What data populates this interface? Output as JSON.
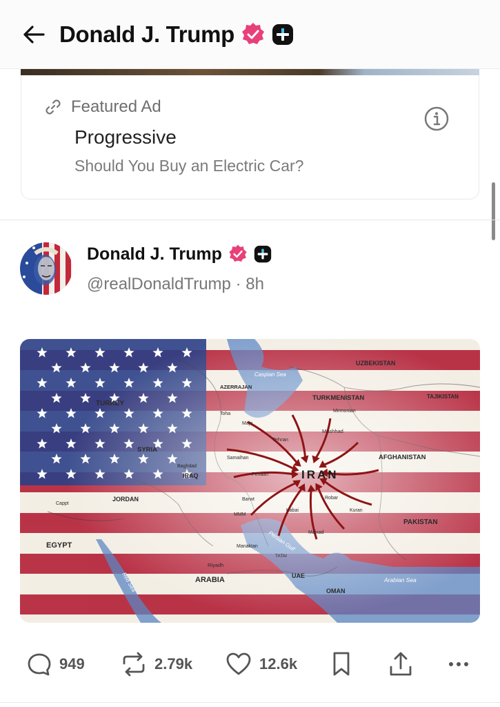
{
  "header": {
    "title": "Donald J. Trump",
    "back_icon": "back-arrow-icon",
    "verified_icon": "verified-badge-icon",
    "plus_icon": "plus-badge-icon"
  },
  "ad": {
    "label": "Featured Ad",
    "title": "Progressive",
    "subtitle": "Should You Buy an Electric Car?",
    "link_icon": "link-icon",
    "info_icon": "info-icon"
  },
  "post": {
    "author": "Donald J. Trump",
    "handle": "@realDonaldTrump",
    "separator": "·",
    "time": "8h",
    "image": {
      "center_label": "IRAN",
      "labels": {
        "uzbekistan": "UZBEKISTAN",
        "turkmenistan": "TURKMENISTAN",
        "tajikistan": "TAJIKISTAN",
        "afghanistan": "AFGHANISTAN",
        "pakistan": "PAKISTAN",
        "turkey": "TURKEY",
        "syria": "SYRIA",
        "jordan": "JORDAN",
        "iraq": "IRAQ",
        "egypt": "EGYPT",
        "arabia": "ARABIA",
        "uae": "UAE",
        "oman": "OMAN",
        "azerbaijan": "AZERRAJAN",
        "caspian": "Caspian Sea",
        "arabian_sea": "Arabian Sea",
        "persian_gulf": "Persian Gulf",
        "red_sea": "Red Sea",
        "tehran": "Tehran",
        "mashhad": "Mashhad",
        "mirmonian": "Mirmonian",
        "riyadh": "Riyadh",
        "baghdad": "Baghdad",
        "kabul": "Kabai",
        "kuran": "Kuran",
        "robar": "Robar",
        "cappt": "Cappt",
        "toha": "Toha",
        "majo": "Majo",
        "samaihan": "Samaihan",
        "penaan": "Penaan",
        "barwt": "Barwt",
        "mamm": "MMM",
        "manaktan": "Manaktan",
        "tatai": "TATAI",
        "maixad": "Maixad"
      },
      "colors": {
        "red": "#b5243a",
        "blue": "#2b3f86",
        "white": "#f3eee4",
        "arrow": "#8e1414"
      }
    }
  },
  "actions": {
    "reply": {
      "icon": "reply-icon",
      "count": "949"
    },
    "repost": {
      "icon": "repost-icon",
      "count": "2.79k"
    },
    "like": {
      "icon": "heart-icon",
      "count": "12.6k"
    },
    "bookmark": {
      "icon": "bookmark-icon"
    },
    "share": {
      "icon": "share-icon"
    },
    "more": {
      "icon": "more-icon"
    }
  }
}
